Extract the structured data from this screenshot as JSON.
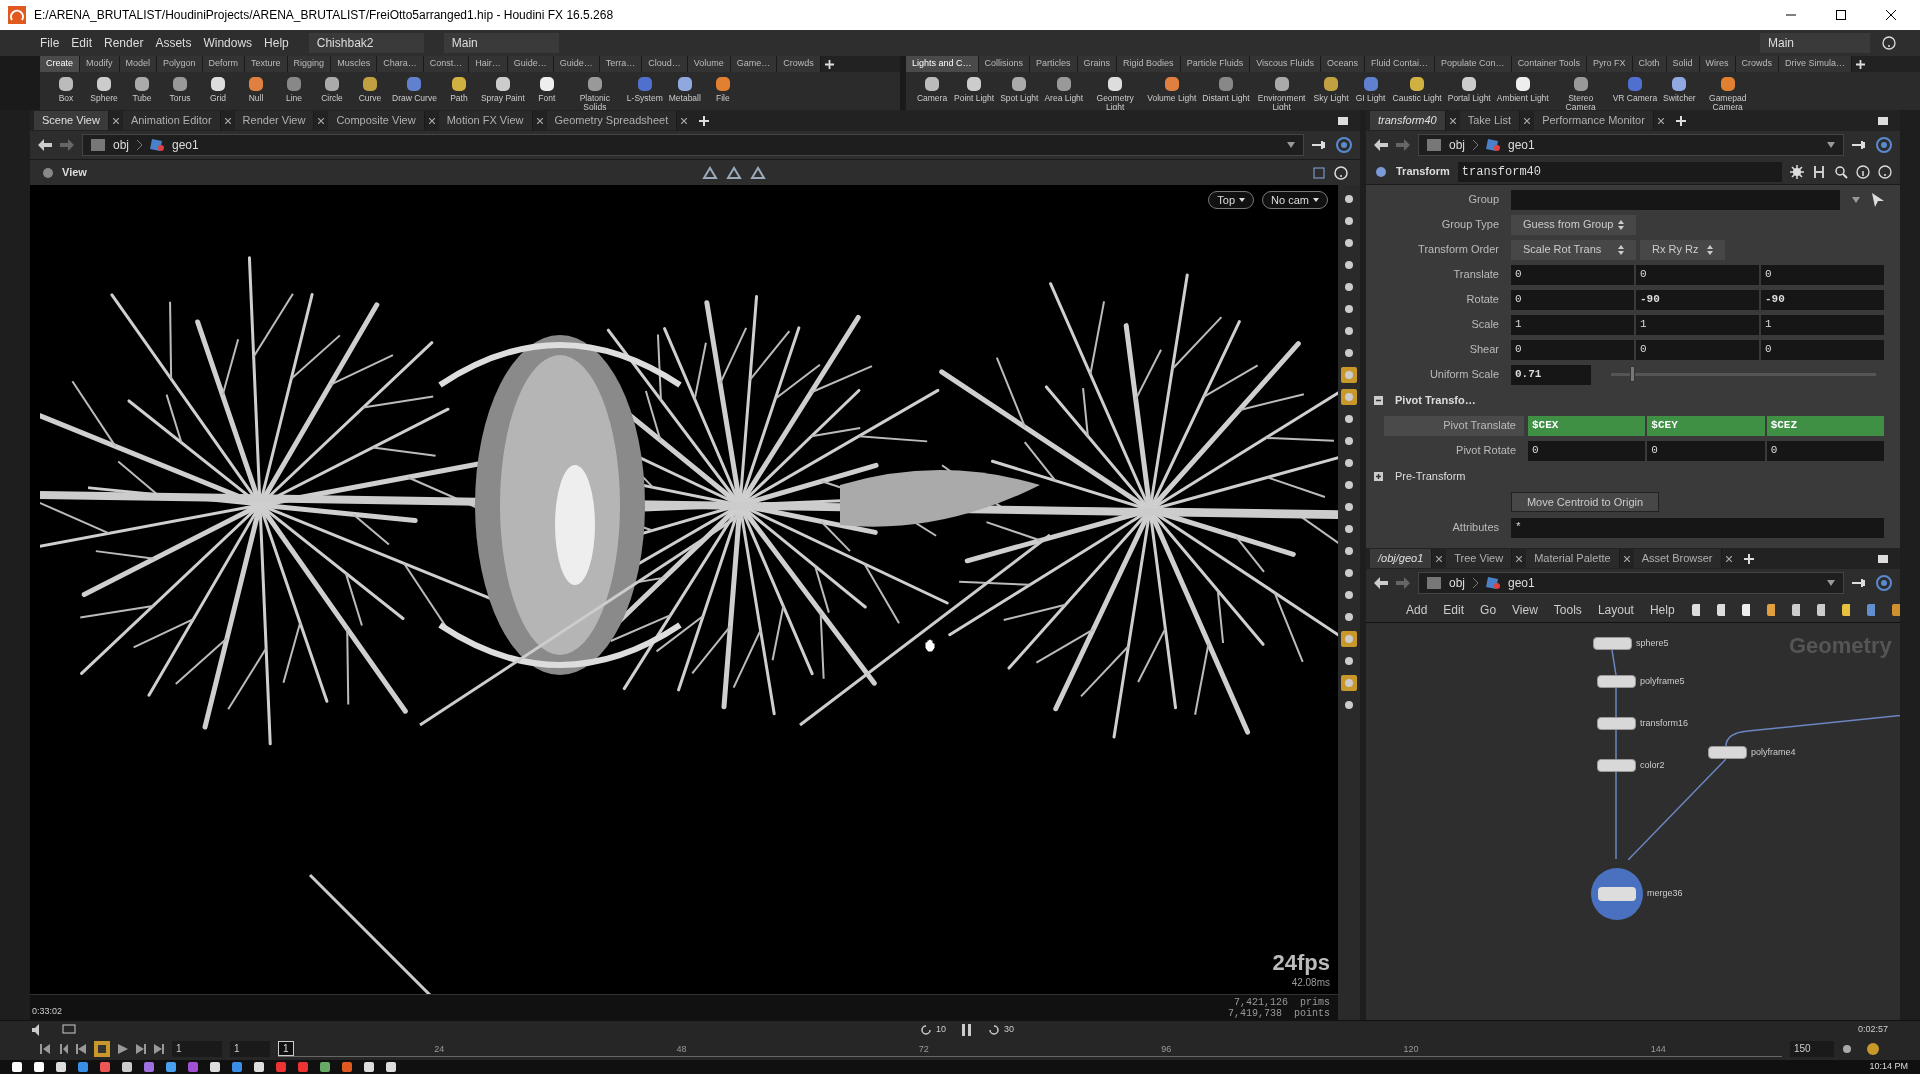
{
  "window": {
    "title": "E:/ARENA_BRUTALIST/HoudiniProjects/ARENA_BRUTALIST/FreiOtto5arranged1.hip - Houdini FX 16.5.268"
  },
  "menu": [
    "File",
    "Edit",
    "Render",
    "Assets",
    "Windows",
    "Help"
  ],
  "desktops": [
    "Chishbak2",
    "Main"
  ],
  "right_desktop": "Main",
  "shelf_left": {
    "tabs": [
      {
        "label": "Create",
        "selected": true
      },
      {
        "label": "Modify",
        "selected": false
      },
      {
        "label": "Model",
        "selected": false
      },
      {
        "label": "Polygon",
        "selected": false
      },
      {
        "label": "Deform",
        "selected": false
      },
      {
        "label": "Texture",
        "selected": false
      },
      {
        "label": "Rigging",
        "selected": false
      },
      {
        "label": "Muscles",
        "selected": false
      },
      {
        "label": "Chara…",
        "selected": false
      },
      {
        "label": "Const…",
        "selected": false
      },
      {
        "label": "Hair…",
        "selected": false
      },
      {
        "label": "Guide…",
        "selected": false
      },
      {
        "label": "Guide…",
        "selected": false
      },
      {
        "label": "Terra…",
        "selected": false
      },
      {
        "label": "Cloud…",
        "selected": false
      },
      {
        "label": "Volume",
        "selected": false
      },
      {
        "label": "Game…",
        "selected": false
      },
      {
        "label": "Crowds",
        "selected": false
      }
    ],
    "tools": [
      "Box",
      "Sphere",
      "Tube",
      "Torus",
      "Grid",
      "Null",
      "Line",
      "Circle",
      "Curve",
      "Draw Curve",
      "Path",
      "Spray Paint",
      "Font",
      "Platonic Solids",
      "L-System",
      "Metaball",
      "File"
    ]
  },
  "shelf_right": {
    "tabs": [
      {
        "label": "Lights and C…",
        "selected": true
      },
      {
        "label": "Collisions",
        "selected": false
      },
      {
        "label": "Particles",
        "selected": false
      },
      {
        "label": "Grains",
        "selected": false
      },
      {
        "label": "Rigid Bodies",
        "selected": false
      },
      {
        "label": "Particle Fluids",
        "selected": false
      },
      {
        "label": "Viscous Fluids",
        "selected": false
      },
      {
        "label": "Oceans",
        "selected": false
      },
      {
        "label": "Fluid Contai…",
        "selected": false
      },
      {
        "label": "Populate Con…",
        "selected": false
      },
      {
        "label": "Container Tools",
        "selected": false
      },
      {
        "label": "Pyro FX",
        "selected": false
      },
      {
        "label": "Cloth",
        "selected": false
      },
      {
        "label": "Solid",
        "selected": false
      },
      {
        "label": "Wires",
        "selected": false
      },
      {
        "label": "Crowds",
        "selected": false
      },
      {
        "label": "Drive Simula…",
        "selected": false
      }
    ],
    "tools": [
      "Camera",
      "Point Light",
      "Spot Light",
      "Area Light",
      "Geometry Light",
      "Volume Light",
      "Distant Light",
      "Environment Light",
      "Sky Light",
      "GI Light",
      "Caustic Light",
      "Portal Light",
      "Ambient Light",
      "Stereo Camera",
      "VR Camera",
      "Switcher",
      "Gamepad Camera"
    ]
  },
  "left_pane": {
    "tabs": [
      {
        "label": "Scene View",
        "selected": true
      },
      {
        "label": "Animation Editor",
        "selected": false
      },
      {
        "label": "Render View",
        "selected": false
      },
      {
        "label": "Composite View",
        "selected": false
      },
      {
        "label": "Motion FX View",
        "selected": false
      },
      {
        "label": "Geometry Spreadsheet",
        "selected": false
      }
    ],
    "path": [
      "obj",
      "geo1"
    ],
    "viewport": {
      "label": "View",
      "view_menu": "Top",
      "camera_menu": "No cam",
      "fps": "24fps",
      "frame_time": "42.08ms",
      "stats": [
        {
          "value": "7,421,126",
          "unit": "prims"
        },
        {
          "value": "7,419,738",
          "unit": "points"
        }
      ]
    }
  },
  "param_pane": {
    "tabs": [
      {
        "label": "transform40",
        "selected": true
      },
      {
        "label": "Take List",
        "selected": false
      },
      {
        "label": "Performance Monitor",
        "selected": false
      }
    ],
    "path": [
      "obj",
      "geo1"
    ],
    "node_type": "Transform",
    "node_name": "transform40",
    "rows": [
      {
        "kind": "field",
        "label": "Group",
        "values": []
      },
      {
        "kind": "menus",
        "label": "Group Type",
        "values": [
          "Guess from Group"
        ]
      },
      {
        "kind": "menus",
        "label": "Transform Order",
        "values": [
          "Scale Rot Trans",
          "Rx Ry Rz"
        ]
      },
      {
        "kind": "vector",
        "label": "Translate",
        "values": [
          "0",
          "0",
          "0"
        ]
      },
      {
        "kind": "vector",
        "label": "Rotate",
        "values": [
          "0",
          "-90",
          "-90"
        ]
      },
      {
        "kind": "vector",
        "label": "Scale",
        "values": [
          "1",
          "1",
          "1"
        ]
      },
      {
        "kind": "vector",
        "label": "Shear",
        "values": [
          "0",
          "0",
          "0"
        ]
      },
      {
        "kind": "slider",
        "label": "Uniform Scale",
        "values": [
          "0.71"
        ],
        "level": 0.07
      }
    ],
    "folders": [
      {
        "label": "Pivot Transfo…",
        "expanded": true,
        "rows": [
          {
            "label": "Pivot Translate",
            "highlighted": true,
            "values": [
              "$CEX",
              "$CEY",
              "$CEZ"
            ]
          },
          {
            "label": "Pivot Rotate",
            "highlighted": false,
            "values": [
              "0",
              "0",
              "0"
            ]
          }
        ]
      },
      {
        "label": "Pre-Transform",
        "expanded": false
      }
    ],
    "button": "Move Centroid to Origin",
    "attributes": {
      "label": "Attributes",
      "value": "*"
    }
  },
  "network_pane": {
    "tabs": [
      {
        "label": "/obj/geo1",
        "selected": true
      },
      {
        "label": "Tree View",
        "selected": false
      },
      {
        "label": "Material Palette",
        "selected": false
      },
      {
        "label": "Asset Browser",
        "selected": false
      }
    ],
    "path": [
      "obj",
      "geo1"
    ],
    "menu": [
      "Add",
      "Edit",
      "Go",
      "View",
      "Tools",
      "Layout",
      "Help"
    ],
    "context_label": "Geometry",
    "nodes": [
      {
        "name": "sphere5",
        "selected": false
      },
      {
        "name": "polyframe5",
        "selected": false
      },
      {
        "name": "transform16",
        "selected": false
      },
      {
        "name": "color2",
        "selected": false
      },
      {
        "name": "polyframe4",
        "selected": false
      },
      {
        "name": "merge36",
        "selected": true
      }
    ]
  },
  "video_overlay": {
    "elapsed": "0:33:02",
    "remaining": "0:02:57",
    "skip_back": "10",
    "skip_forward": "30"
  },
  "timeline": {
    "start_field": "1",
    "frame_field": "1",
    "current_frame": "1",
    "ticks": [
      "24",
      "48",
      "72",
      "96",
      "120",
      "144"
    ],
    "end_field": "150"
  },
  "taskbar": {
    "clock": "10:14 PM"
  }
}
